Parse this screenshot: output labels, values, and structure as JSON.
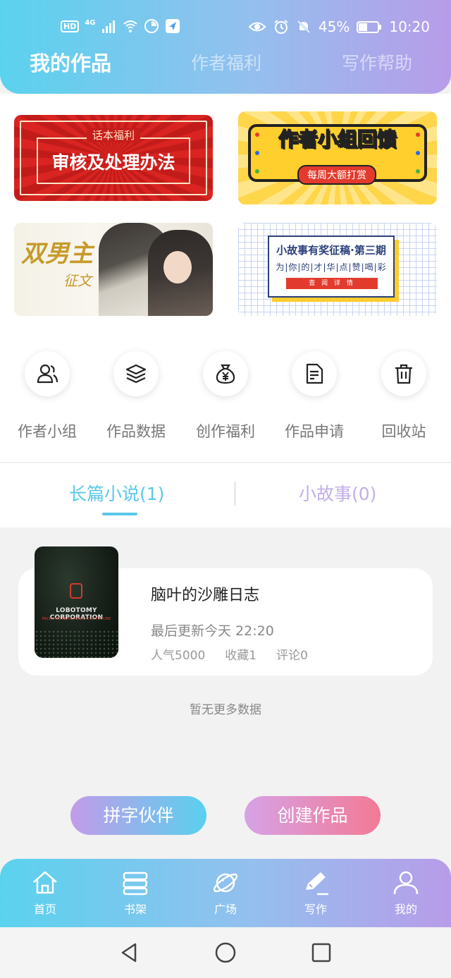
{
  "status_bar": {
    "hd": "HD",
    "network": "4G",
    "battery": "45%",
    "time": "10:20"
  },
  "header": {
    "tabs": [
      "我的作品",
      "作者福利",
      "写作帮助"
    ],
    "active_tab": 0
  },
  "banners": {
    "b1": {
      "tag": "话本福利",
      "title": "审核及处理办法"
    },
    "b2": {
      "title": "作者小组回馈",
      "subtitle": "每周大额打赏"
    },
    "b3": {
      "calligraphy": "双男主",
      "calligraphy_sub": "征文"
    },
    "b4": {
      "title": "小故事有奖征稿·第三期",
      "subtitle": "为|你|的|才|华|点|赞|喝|彩",
      "button": "查 阅 详 情"
    }
  },
  "features": [
    {
      "label": "作者小组",
      "icon": "people-icon"
    },
    {
      "label": "作品数据",
      "icon": "layers-icon"
    },
    {
      "label": "创作福利",
      "icon": "money-bag-icon"
    },
    {
      "label": "作品申请",
      "icon": "document-icon"
    },
    {
      "label": "回收站",
      "icon": "trash-icon"
    }
  ],
  "work_tabs": {
    "long_novel": "长篇小说(1)",
    "short_story": "小故事(0)",
    "active": "long_novel"
  },
  "works": [
    {
      "title": "脑叶的沙雕日志",
      "cover_title": "LOBOTOMY CORPORATION",
      "cover_subtitle": "FACE THE FEAR, MAKE THE FUTURE",
      "updated": "最后更新今天 22:20",
      "popularity": "人气5000",
      "favorites": "收藏1",
      "comments": "评论0"
    }
  ],
  "empty_hint": "暂无更多数据",
  "actions": {
    "partner": "拼字伙伴",
    "create": "创建作品"
  },
  "bottom_nav": [
    {
      "label": "首页",
      "icon": "home-icon"
    },
    {
      "label": "书架",
      "icon": "bookshelf-icon"
    },
    {
      "label": "广场",
      "icon": "planet-icon"
    },
    {
      "label": "写作",
      "icon": "pen-icon"
    },
    {
      "label": "我的",
      "icon": "user-icon"
    }
  ],
  "colors": {
    "header_gradient_start": "#5ad2ee",
    "header_gradient_end": "#b89ce9",
    "tab_active": "#5ac8e8",
    "tab_inactive": "#c2aee8",
    "create_button": "#f37a96"
  }
}
